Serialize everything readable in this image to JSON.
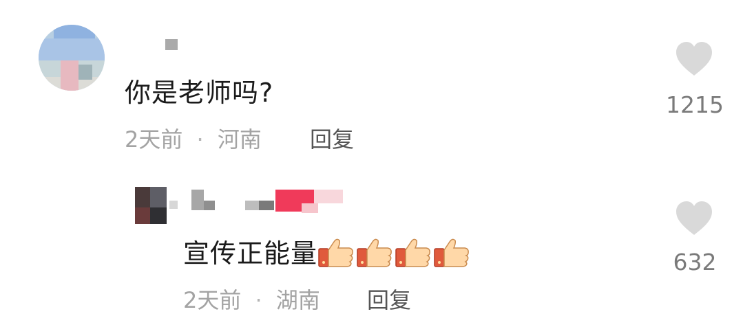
{
  "comment": {
    "text": "你是老师吗?",
    "time": "2天前",
    "separator": "·",
    "location": "河南",
    "reply_label": "回复",
    "like_count": "1215"
  },
  "reply": {
    "text": "宣传正能量",
    "emoji": [
      "👍",
      "👍",
      "👍",
      "👍"
    ],
    "time": "2天前",
    "separator": "·",
    "location": "湖南",
    "reply_label": "回复",
    "like_count": "632"
  },
  "colors": {
    "text": "#1a1a1a",
    "meta": "#a3a3a3",
    "heart": "#d9d9d9",
    "count": "#7a7a7a",
    "redacted_pink": "#f03a5a"
  },
  "icons": {
    "like": "heart-icon",
    "emoji": "thumbs-up-icon"
  }
}
